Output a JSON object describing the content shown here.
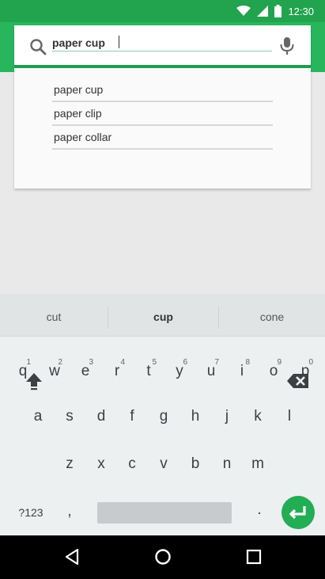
{
  "status": {
    "time": "12:30"
  },
  "search": {
    "value": "paper cup"
  },
  "suggestions": [
    {
      "label": "paper cup"
    },
    {
      "label": "paper clip"
    },
    {
      "label": "paper collar"
    }
  ],
  "keyboard": {
    "suggestion_strip": [
      "cut",
      "cup",
      "cone"
    ],
    "row1": [
      {
        "key": "q",
        "hint": "1"
      },
      {
        "key": "w",
        "hint": "2"
      },
      {
        "key": "e",
        "hint": "3"
      },
      {
        "key": "r",
        "hint": "4"
      },
      {
        "key": "t",
        "hint": "5"
      },
      {
        "key": "y",
        "hint": "6"
      },
      {
        "key": "u",
        "hint": "7"
      },
      {
        "key": "i",
        "hint": "8"
      },
      {
        "key": "o",
        "hint": "9"
      },
      {
        "key": "p",
        "hint": "0"
      }
    ],
    "row2": [
      "a",
      "s",
      "d",
      "f",
      "g",
      "h",
      "j",
      "k",
      "l"
    ],
    "row3": [
      "z",
      "x",
      "c",
      "v",
      "b",
      "n",
      "m"
    ],
    "symbols_label": "?123",
    "comma": ",",
    "period": "."
  },
  "colors": {
    "accent": "#28b65c",
    "status_bar": "#22a34e",
    "enter": "#23ad55"
  },
  "icons": [
    "wifi-icon",
    "cell-signal-icon",
    "battery-icon",
    "search-icon",
    "mic-icon",
    "shift-icon",
    "backspace-icon",
    "enter-icon",
    "back-icon",
    "home-icon",
    "recents-icon"
  ]
}
